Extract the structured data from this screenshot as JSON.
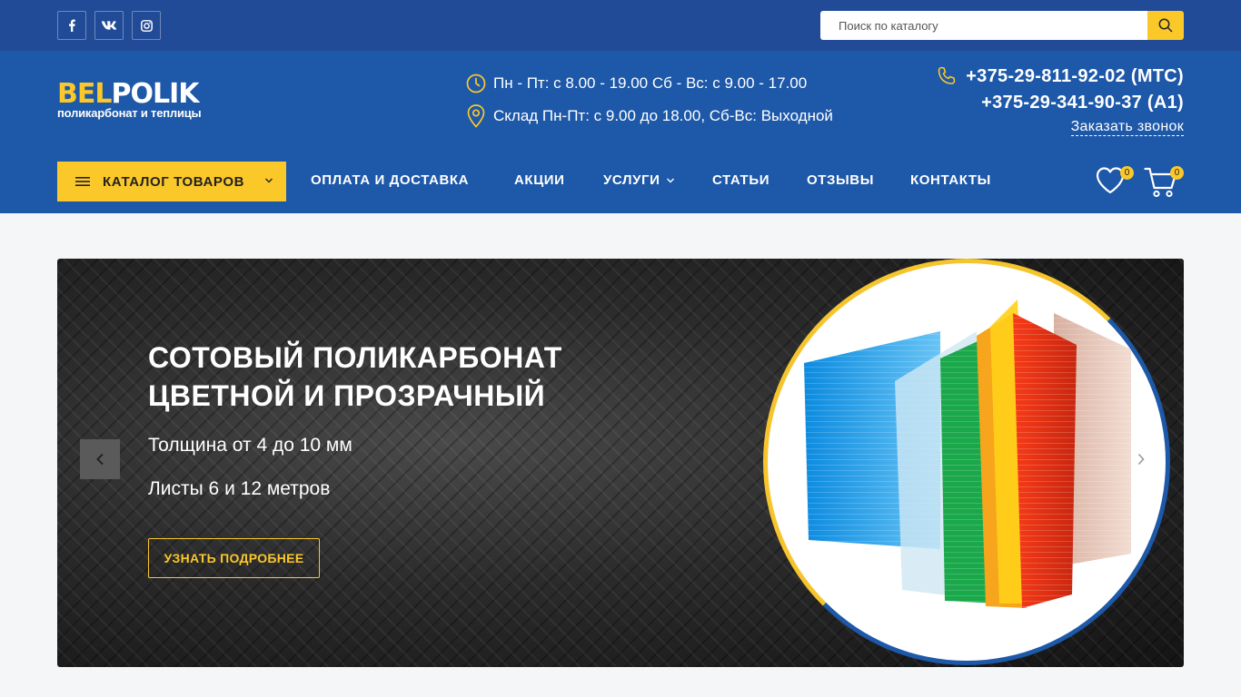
{
  "topbar": {
    "social": [
      "facebook-icon",
      "vk-icon",
      "instagram-icon"
    ],
    "search": {
      "placeholder": "Поиск по каталогу"
    }
  },
  "header": {
    "logo": {
      "part1": "BEL",
      "part2": "POLIK",
      "tagline": "поликарбонат и теплицы"
    },
    "hours": "Пн - Пт: с 8.00 - 19.00 Сб - Вс: с 9.00 - 17.00",
    "warehouse": "Склад Пн-Пт: с 9.00 до 18.00, Сб-Вс: Выходной",
    "phones": [
      "+375-29-811-92-02 (МТС)",
      "+375-29-341-90-37 (A1)"
    ],
    "callback": "Заказать звонок"
  },
  "nav": {
    "catalog": "КАТАЛОГ ТОВАРОВ",
    "items": [
      "ОПЛАТА И ДОСТАВКА",
      "АКЦИИ",
      "УСЛУГИ",
      "СТАТЬИ",
      "ОТЗЫВЫ",
      "КОНТАКТЫ"
    ],
    "wishlist_count": "0",
    "cart_count": "0"
  },
  "slider": {
    "title_line1": "СОТОВЫЙ ПОЛИКАРБОНАТ",
    "title_line2": "ЦВЕТНОЙ И ПРОЗРАЧНЫЙ",
    "line1": "Толщина от 4 до 10 мм",
    "line2": "Листы 6 и 12 метров",
    "button": "УЗНАТЬ ПОДРОБНЕЕ"
  },
  "colors": {
    "topbar": "#214b96",
    "header": "#1d58a9",
    "accent": "#fbc82a"
  }
}
